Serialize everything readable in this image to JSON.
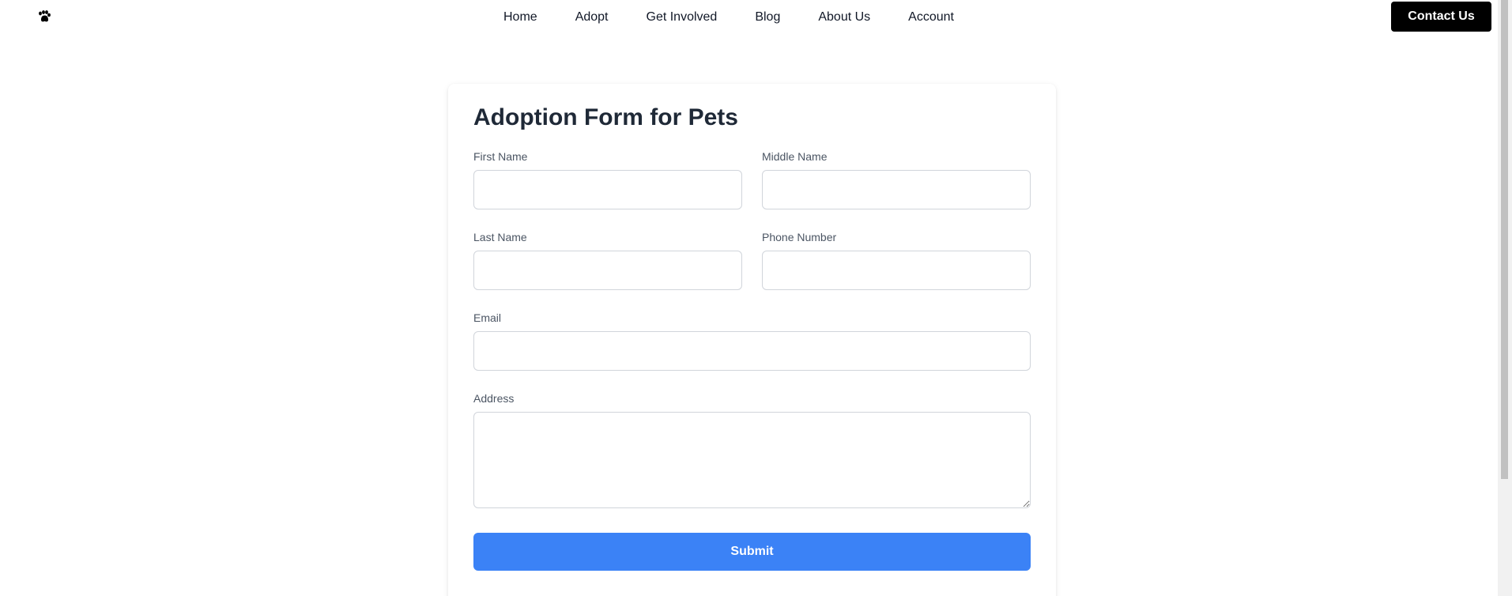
{
  "header": {
    "logo_icon": "paw-icon",
    "nav": [
      {
        "label": "Home"
      },
      {
        "label": "Adopt"
      },
      {
        "label": "Get Involved"
      },
      {
        "label": "Blog"
      },
      {
        "label": "About Us"
      },
      {
        "label": "Account"
      }
    ],
    "contact_label": "Contact Us"
  },
  "form": {
    "title": "Adoption Form for Pets",
    "fields": {
      "first_name": {
        "label": "First Name",
        "value": ""
      },
      "middle_name": {
        "label": "Middle Name",
        "value": ""
      },
      "last_name": {
        "label": "Last Name",
        "value": ""
      },
      "phone_number": {
        "label": "Phone Number",
        "value": ""
      },
      "email": {
        "label": "Email",
        "value": ""
      },
      "address": {
        "label": "Address",
        "value": ""
      }
    },
    "submit_label": "Submit"
  },
  "colors": {
    "primary": "#3b82f6",
    "contact_bg": "#000000"
  }
}
